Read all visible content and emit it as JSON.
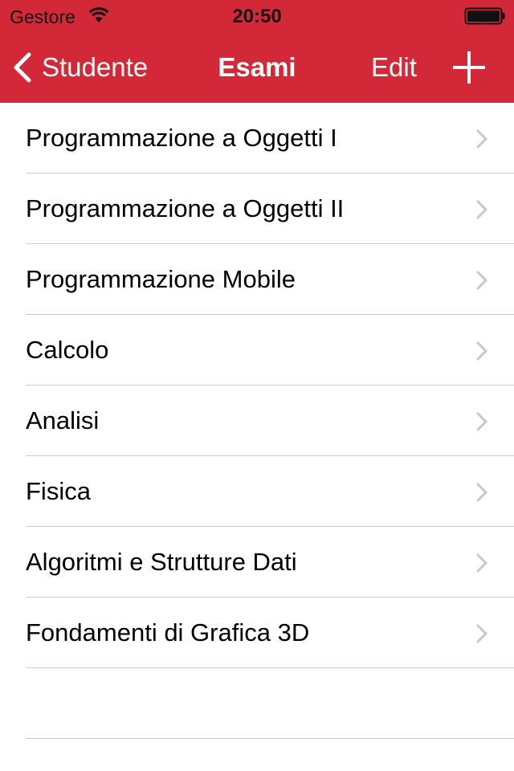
{
  "colors": {
    "accent": "#d32838",
    "separator": "#c8c7cc",
    "chevron": "#c7c7cc"
  },
  "status_bar": {
    "carrier": "Gestore",
    "time": "20:50",
    "wifi_icon": "wifi-icon",
    "battery_icon": "battery-icon"
  },
  "nav": {
    "back_label": "Studente",
    "title": "Esami",
    "edit_label": "Edit",
    "add_icon": "plus-icon"
  },
  "exams": [
    "Programmazione a Oggetti I",
    "Programmazione a Oggetti II",
    "Programmazione Mobile",
    "Calcolo",
    "Analisi",
    "Fisica",
    "Algoritmi e Strutture Dati",
    "Fondamenti di Grafica 3D"
  ]
}
